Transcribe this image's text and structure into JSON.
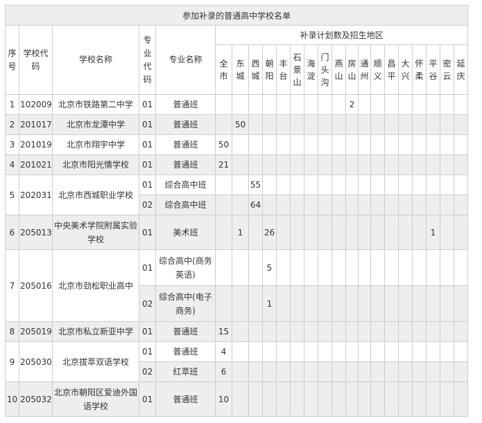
{
  "table": {
    "title": "参加补录的普通高中学校名单",
    "headers": {
      "seq": "序号",
      "code": "学校代码",
      "name": "学校名称",
      "major_code": "专业代码",
      "major_name": "专业名称",
      "plan": "补录计划数及招生地区"
    },
    "regions": [
      "全市",
      "东城",
      "西城",
      "朝阳",
      "丰台",
      "石景山",
      "海淀",
      "门头沟",
      "燕山",
      "房山",
      "通州",
      "顺义",
      "昌平",
      "大兴",
      "怀柔",
      "平谷",
      "密云",
      "延庆"
    ],
    "schools": [
      {
        "seq": "1",
        "code": "102009",
        "name": "北京市铁路第二中学",
        "majors": [
          {
            "code": "01",
            "name": "普通班",
            "counts": {
              "房山": "2"
            }
          }
        ]
      },
      {
        "seq": "2",
        "code": "201017",
        "name": "北京市龙潭中学",
        "majors": [
          {
            "code": "01",
            "name": "普通班",
            "counts": {
              "东城": "50"
            }
          }
        ]
      },
      {
        "seq": "3",
        "code": "201019",
        "name": "北京市翔宇中学",
        "majors": [
          {
            "code": "01",
            "name": "普通班",
            "counts": {
              "全市": "50"
            }
          }
        ]
      },
      {
        "seq": "4",
        "code": "201021",
        "name": "北京市阳光情学校",
        "majors": [
          {
            "code": "01",
            "name": "普通班",
            "counts": {
              "全市": "21"
            }
          }
        ]
      },
      {
        "seq": "5",
        "code": "202031",
        "name": "北京市西城职业学校",
        "majors": [
          {
            "code": "01",
            "name": "综合高中班",
            "counts": {
              "西城": "55"
            }
          },
          {
            "code": "02",
            "name": "综合高中班",
            "counts": {
              "西城": "64"
            }
          }
        ]
      },
      {
        "seq": "6",
        "code": "205013",
        "name": "中央美术学院附属实验学校",
        "majors": [
          {
            "code": "01",
            "name": "美术班",
            "counts": {
              "东城": "1",
              "朝阳": "26",
              "平谷": "1"
            }
          }
        ]
      },
      {
        "seq": "7",
        "code": "205016",
        "name": "北京市劲松职业高中",
        "majors": [
          {
            "code": "01",
            "name": "综合高中(商务英语)",
            "counts": {
              "朝阳": "5"
            }
          },
          {
            "code": "02",
            "name": "综合高中(电子商务)",
            "counts": {
              "朝阳": "1"
            }
          }
        ]
      },
      {
        "seq": "8",
        "code": "205019",
        "name": "北京市私立新亚中学",
        "majors": [
          {
            "code": "01",
            "name": "普通班",
            "counts": {
              "全市": "15"
            }
          }
        ]
      },
      {
        "seq": "9",
        "code": "205030",
        "name": "北京拔萃双语学校",
        "majors": [
          {
            "code": "01",
            "name": "普通班",
            "counts": {
              "全市": "4"
            }
          },
          {
            "code": "02",
            "name": "红萃班",
            "counts": {
              "全市": "6"
            }
          }
        ]
      },
      {
        "seq": "10",
        "code": "205032",
        "name": "北京市朝阳区爱迪外国语学校",
        "majors": [
          {
            "code": "01",
            "name": "普通班",
            "counts": {
              "全市": "10"
            }
          }
        ]
      }
    ]
  }
}
